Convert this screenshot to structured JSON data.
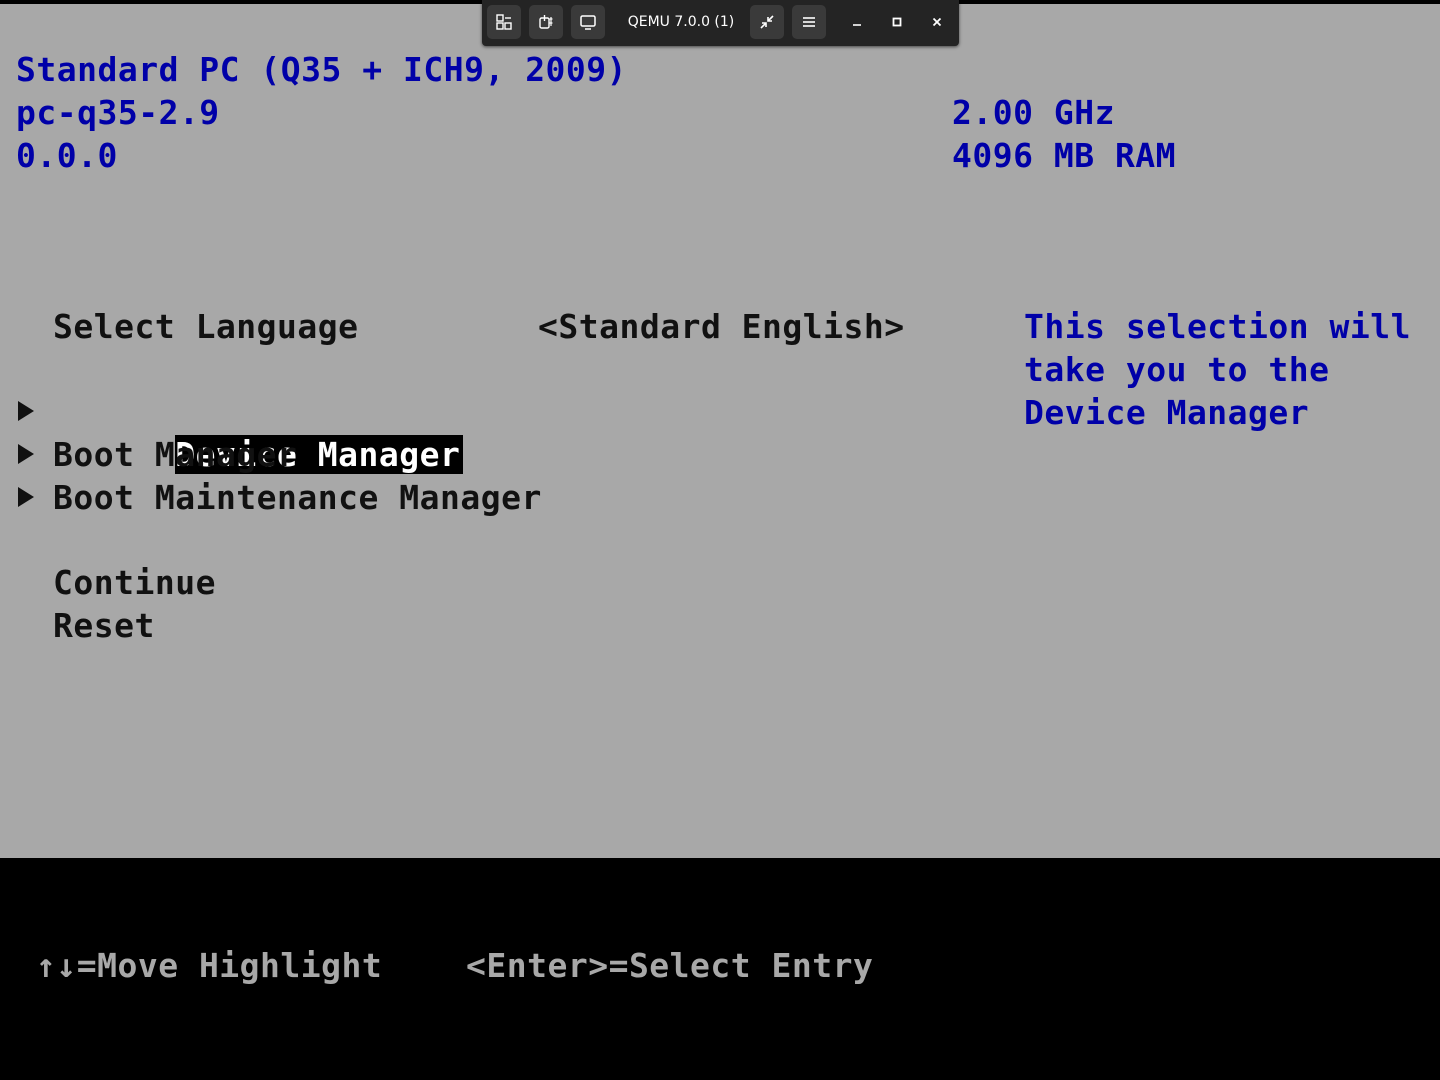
{
  "window": {
    "title": "QEMU 7.0.0 (1)",
    "toolbar_icons": [
      "tabs-icon",
      "keyboard-shortcut-icon",
      "display-icon",
      "exit-fullscreen-icon",
      "hamburger-menu-icon",
      "minimize-icon",
      "maximize-icon",
      "close-icon"
    ]
  },
  "system_info": {
    "machine": "Standard PC (Q35 + ICH9, 2009)",
    "version": "pc-q35-2.9",
    "firmware": "0.0.0",
    "cpu_speed": "2.00 GHz",
    "memory": "4096 MB RAM"
  },
  "language": {
    "label": "Select Language",
    "value": "<Standard English>"
  },
  "menu": {
    "items": [
      {
        "label": "Device Manager",
        "selected": true
      },
      {
        "label": "Boot Manager",
        "selected": false
      },
      {
        "label": "Boot Maintenance Manager",
        "selected": false
      }
    ],
    "actions": [
      {
        "label": "Continue"
      },
      {
        "label": "Reset"
      }
    ]
  },
  "help": {
    "lines": [
      "This selection will",
      "take you to the",
      "Device Manager"
    ]
  },
  "footer": {
    "move_hint": "↑↓=Move Highlight",
    "select_hint": "<Enter>=Select Entry"
  },
  "colors": {
    "main_bg": "#a8a8a8",
    "info_text": "#0000a8",
    "footer_bg": "#000000",
    "highlight_bg": "#000000",
    "highlight_text": "#ffffff"
  }
}
